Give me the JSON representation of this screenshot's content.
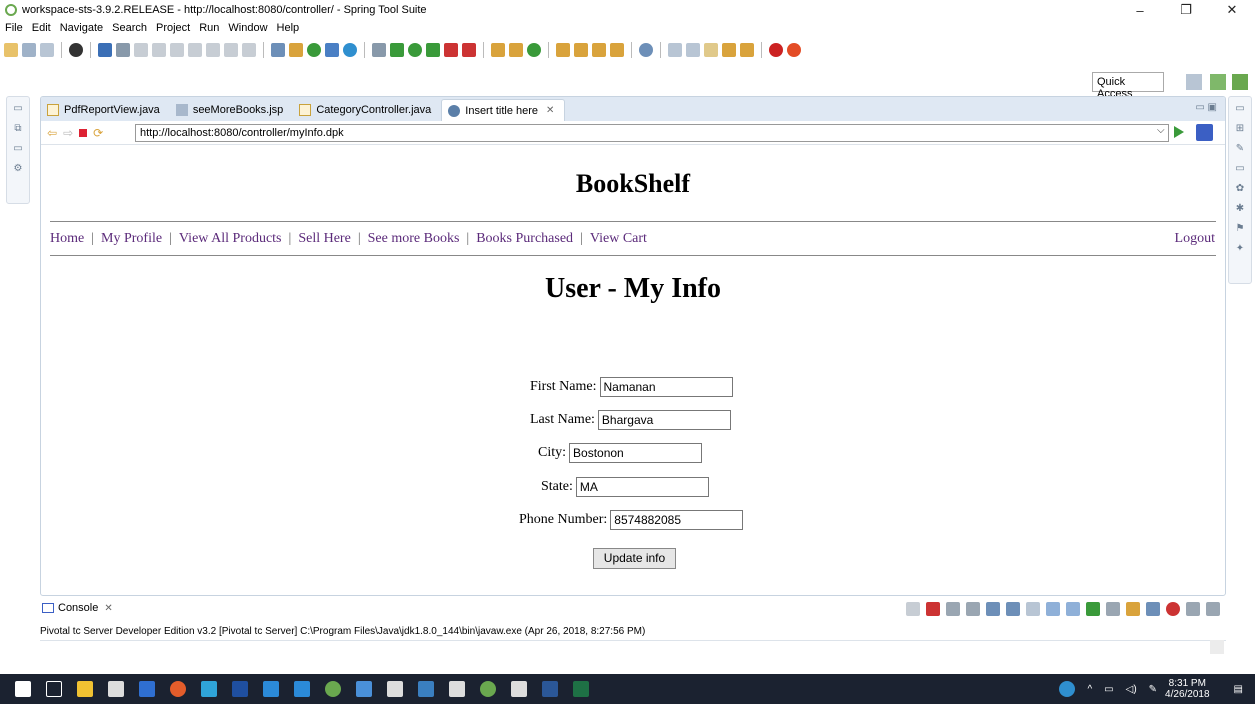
{
  "window": {
    "title": "workspace-sts-3.9.2.RELEASE - http://localhost:8080/controller/ - Spring Tool Suite"
  },
  "menu": [
    "File",
    "Edit",
    "Navigate",
    "Search",
    "Project",
    "Run",
    "Window",
    "Help"
  ],
  "quick_access": "Quick Access",
  "tabs": [
    {
      "label": "PdfReportView.java"
    },
    {
      "label": "seeMoreBooks.jsp"
    },
    {
      "label": "CategoryController.java"
    },
    {
      "label": "Insert title here"
    }
  ],
  "browser": {
    "url": "http://localhost:8080/controller/myInfo.dpk"
  },
  "page": {
    "site_title": "BookShelf",
    "nav": [
      "Home",
      "My Profile",
      "View All Products",
      "Sell Here",
      "See more Books",
      "Books Purchased",
      "View Cart"
    ],
    "logout": "Logout",
    "heading": "User - My Info",
    "form": {
      "first_name_label": "First Name:",
      "first_name": "Namanan",
      "last_name_label": "Last Name:",
      "last_name": "Bhargava",
      "city_label": "City:",
      "city": "Bostonon",
      "state_label": "State:",
      "state": "MA",
      "phone_label": "Phone Number:",
      "phone": "8574882085",
      "update_label": "Update info"
    }
  },
  "console": {
    "tab_label": "Console",
    "text": "Pivotal tc Server Developer Edition v3.2 [Pivotal tc Server] C:\\Program Files\\Java\\jdk1.8.0_144\\bin\\javaw.exe (Apr 26, 2018, 8:27:56 PM)"
  },
  "taskbar": {
    "time": "8:31 PM",
    "date": "4/26/2018"
  },
  "colors": {
    "taskbar_bg": "#1b2230",
    "link": "#5b2a7a",
    "tab_strip": "#dfe8f3"
  }
}
